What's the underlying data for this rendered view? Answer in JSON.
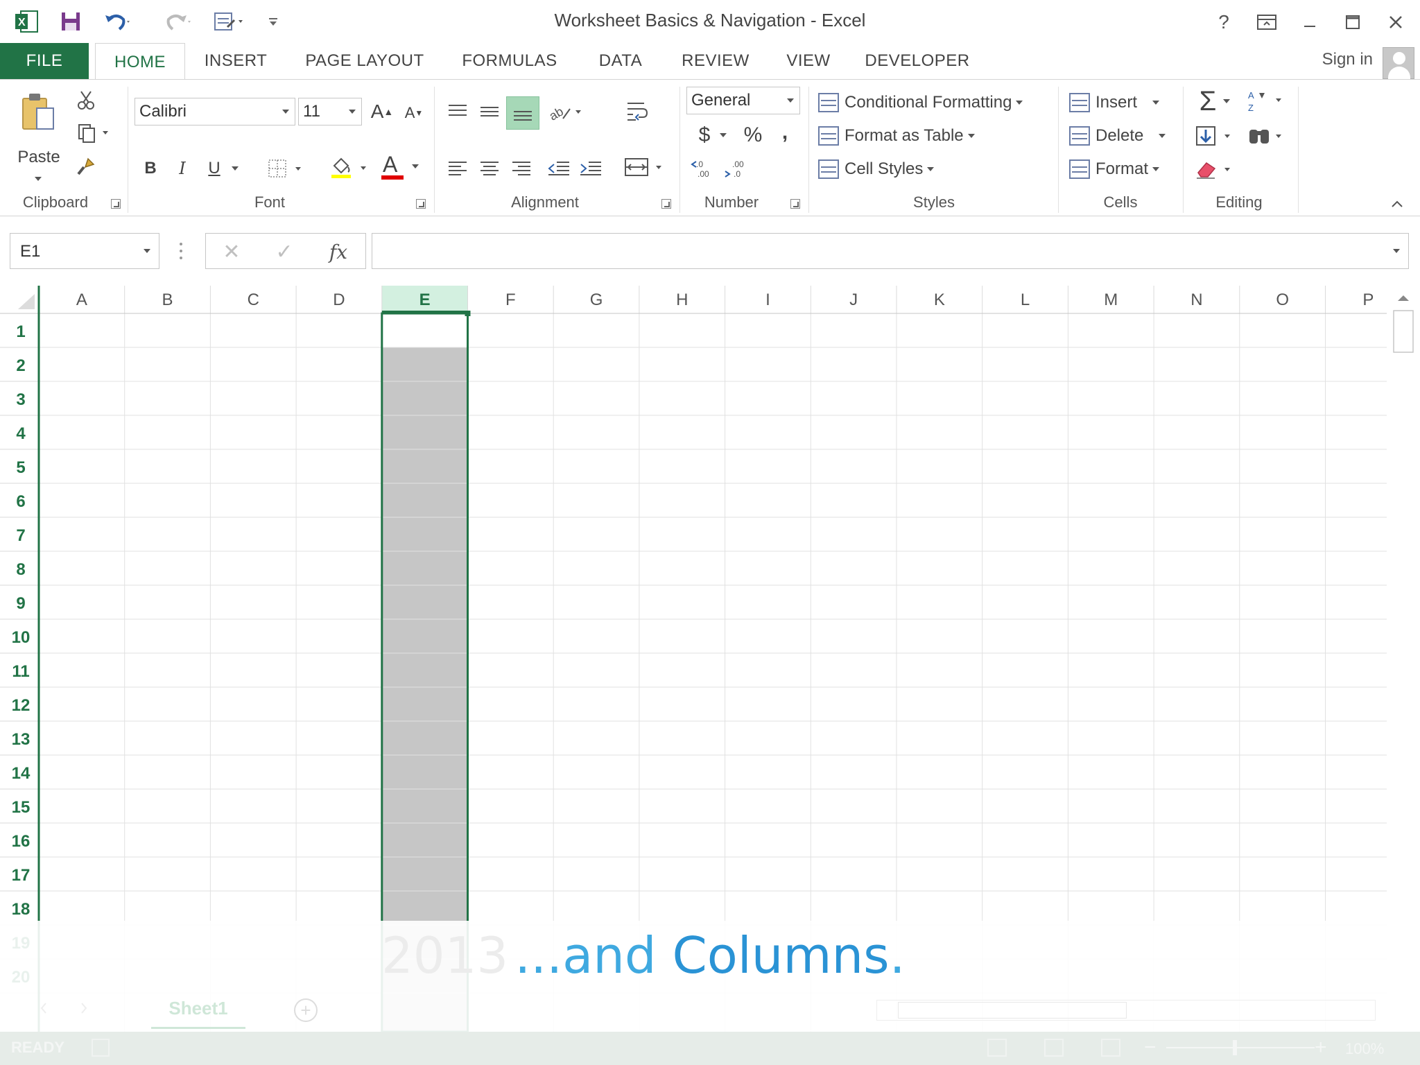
{
  "window": {
    "title": "Worksheet Basics & Navigation - Excel",
    "help_label": "?",
    "app_icon": "excel-logo-icon"
  },
  "tabs": [
    "FILE",
    "HOME",
    "INSERT",
    "PAGE LAYOUT",
    "FORMULAS",
    "DATA",
    "REVIEW",
    "VIEW",
    "DEVELOPER"
  ],
  "active_tab": "HOME",
  "account": {
    "sign_in_label": "Sign in"
  },
  "ribbon": {
    "clipboard": {
      "label": "Clipboard",
      "paste_label": "Paste"
    },
    "font": {
      "label": "Font",
      "font_name": "Calibri",
      "font_size": "11",
      "bold": "B",
      "italic": "I",
      "underline": "U",
      "grow": "A",
      "shrink": "A",
      "font_color_glyph": "A",
      "font_color": "#e00000"
    },
    "alignment": {
      "label": "Alignment"
    },
    "number": {
      "label": "Number",
      "format": "General",
      "currency": "$",
      "percent": "%",
      "comma": ","
    },
    "styles": {
      "label": "Styles",
      "conditional_formatting": "Conditional Formatting",
      "format_as_table": "Format as Table",
      "cell_styles": "Cell Styles"
    },
    "cells": {
      "label": "Cells",
      "insert": "Insert",
      "delete": "Delete",
      "format": "Format"
    },
    "editing": {
      "label": "Editing",
      "sum_glyph": "Σ"
    }
  },
  "formula_bar": {
    "name_box": "E1",
    "cancel_glyph": "✕",
    "enter_glyph": "✓",
    "fx_label": "fx",
    "value": ""
  },
  "sheet": {
    "columns": [
      "A",
      "B",
      "C",
      "D",
      "E",
      "F",
      "G",
      "H",
      "I",
      "J",
      "K",
      "L",
      "M",
      "N",
      "O",
      "P"
    ],
    "rows": [
      "1",
      "2",
      "3",
      "4",
      "5",
      "6",
      "7",
      "8",
      "9",
      "10",
      "11",
      "12",
      "13",
      "14",
      "15",
      "16",
      "17",
      "18",
      "19",
      "20"
    ],
    "selected_column": "E",
    "active_cell": "E1",
    "accent_color": "#217346",
    "selection_fill": "#c6c6c6"
  },
  "overlay": {
    "caption_prefix": "...and ",
    "caption_highlight": "Columns",
    "caption_suffix": ".",
    "faint_text": "2013",
    "caption_color": "#3fa9e0"
  },
  "sheet_tabs": {
    "active": "Sheet1",
    "add_glyph": "+"
  },
  "status": {
    "mode": "READY",
    "zoom_minus": "−",
    "zoom_plus": "+",
    "zoom_level": "100%"
  },
  "colors": {
    "excel_green": "#217346",
    "header_selected_fill": "#d3f0e0"
  }
}
